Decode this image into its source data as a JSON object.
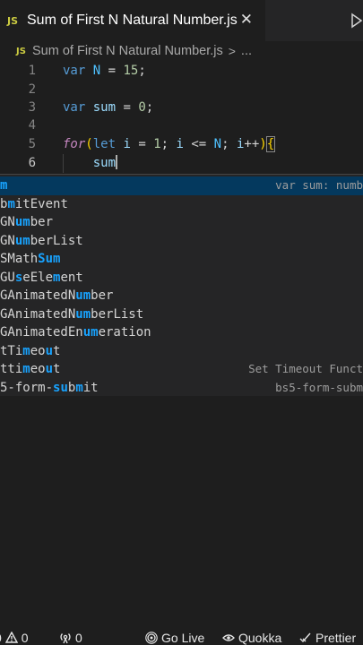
{
  "tab": {
    "badge": "JS",
    "title": "Sum of First N Natural Number.js",
    "close_glyph": "✕"
  },
  "breadcrumb": {
    "badge": "JS",
    "file": "Sum of First N Natural Number.js",
    "sep": ">",
    "more": "..."
  },
  "editor": {
    "lines": [
      {
        "num": "1",
        "tokens": [
          {
            "t": "var",
            "c": "kw"
          },
          {
            "t": " ",
            "c": "op"
          },
          {
            "t": "N",
            "c": "const"
          },
          {
            "t": " = ",
            "c": "op"
          },
          {
            "t": "15",
            "c": "num"
          },
          {
            "t": ";",
            "c": "op"
          }
        ]
      },
      {
        "num": "2",
        "tokens": []
      },
      {
        "num": "3",
        "tokens": [
          {
            "t": "var",
            "c": "kw"
          },
          {
            "t": " ",
            "c": "op"
          },
          {
            "t": "sum",
            "c": "ident"
          },
          {
            "t": " = ",
            "c": "op"
          },
          {
            "t": "0",
            "c": "num"
          },
          {
            "t": ";",
            "c": "op"
          }
        ]
      },
      {
        "num": "4",
        "tokens": []
      },
      {
        "num": "5",
        "tokens": [
          {
            "t": "for",
            "c": "kw-italic"
          },
          {
            "t": "(",
            "c": "brace"
          },
          {
            "t": "let",
            "c": "kw"
          },
          {
            "t": " ",
            "c": "op"
          },
          {
            "t": "i",
            "c": "ident"
          },
          {
            "t": " = ",
            "c": "op"
          },
          {
            "t": "1",
            "c": "num"
          },
          {
            "t": "; ",
            "c": "op"
          },
          {
            "t": "i",
            "c": "ident"
          },
          {
            "t": " <= ",
            "c": "op"
          },
          {
            "t": "N",
            "c": "const"
          },
          {
            "t": "; ",
            "c": "op"
          },
          {
            "t": "i",
            "c": "ident"
          },
          {
            "t": "++",
            "c": "op"
          },
          {
            "t": ")",
            "c": "brace"
          },
          {
            "t": "{",
            "c": "brace-hl"
          }
        ]
      },
      {
        "num": "6",
        "tokens": [
          {
            "t": "    sum",
            "c": "ident"
          }
        ],
        "active": true
      }
    ]
  },
  "suggestions": [
    {
      "pre": "",
      "match": "m",
      "post": "",
      "detail": "var sum: numb",
      "selected": true
    },
    {
      "pre": "b",
      "match": "m",
      "post": "itEvent",
      "detail": ""
    },
    {
      "pre": "GN",
      "match": "um",
      "post": "ber",
      "detail": ""
    },
    {
      "pre": "GN",
      "match": "um",
      "post": "berList",
      "detail": ""
    },
    {
      "pre": "SMath",
      "match": "Sum",
      "post": "",
      "detail": ""
    },
    {
      "pre": "GU",
      "match": "s",
      "post": "eEle",
      "match2": "m",
      "post2": "ent",
      "detail": ""
    },
    {
      "pre": "GAnimatedN",
      "match": "um",
      "post": "ber",
      "detail": ""
    },
    {
      "pre": "GAnimatedN",
      "match": "um",
      "post": "berList",
      "detail": ""
    },
    {
      "pre": "GAnimatedEn",
      "match": "um",
      "post": "eration",
      "detail": ""
    },
    {
      "pre": "tTi",
      "match": "m",
      "post": "eo",
      "match2": "u",
      "post2": "t",
      "detail": ""
    },
    {
      "pre": "tti",
      "match": "m",
      "post": "eo",
      "match2": "u",
      "post2": "t",
      "detail": "Set Timeout Funct"
    },
    {
      "pre": "5-form-",
      "match": "su",
      "post": "b",
      "match2": "m",
      "post2": "it",
      "detail": "bs5-form-subm"
    }
  ],
  "statusbar": {
    "errors": "0",
    "warnings": "0",
    "ports": "0",
    "go_live": "Go Live",
    "quokka": "Quokka",
    "prettier": "Prettier"
  },
  "colors": {
    "editor_bg": "#1e1e1e",
    "suggest_bg": "#252526",
    "suggest_selected": "#04395e",
    "match_highlight": "#18a3ff"
  }
}
